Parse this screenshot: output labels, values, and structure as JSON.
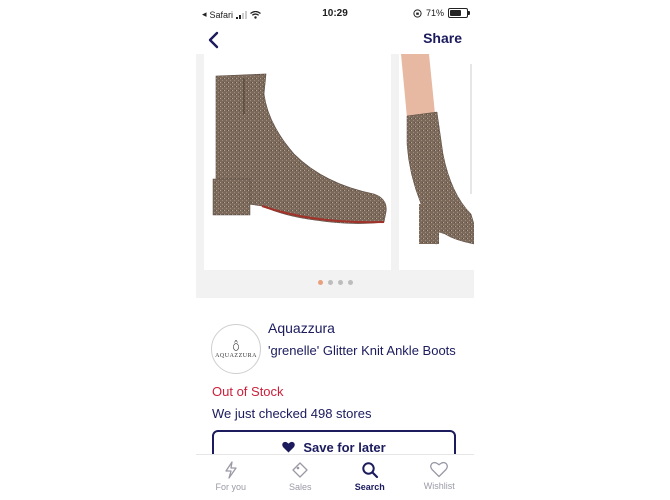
{
  "status_bar": {
    "carrier": "Safari",
    "time": "10:29",
    "battery": "71%"
  },
  "nav": {
    "share_label": "Share"
  },
  "gallery": {
    "image_count": 4,
    "active_index": 0
  },
  "product": {
    "brand": "Aquazzura",
    "name": "'grenelle' Glitter Knit Ankle Boots",
    "logo_text": "AQUAZZURA",
    "stock_status": "Out of Stock",
    "checked_stores": "We just checked 498 stores"
  },
  "actions": {
    "save_label": "Save for later"
  },
  "tabs": [
    {
      "label": "For you",
      "icon": "lightning-icon"
    },
    {
      "label": "Sales",
      "icon": "tag-icon"
    },
    {
      "label": "Search",
      "icon": "search-icon"
    },
    {
      "label": "Wishlist",
      "icon": "heart-icon"
    }
  ],
  "colors": {
    "navy": "#1b1b5e",
    "out_of_stock_red": "#cc1f3a",
    "active_dot": "#e9a07e"
  }
}
